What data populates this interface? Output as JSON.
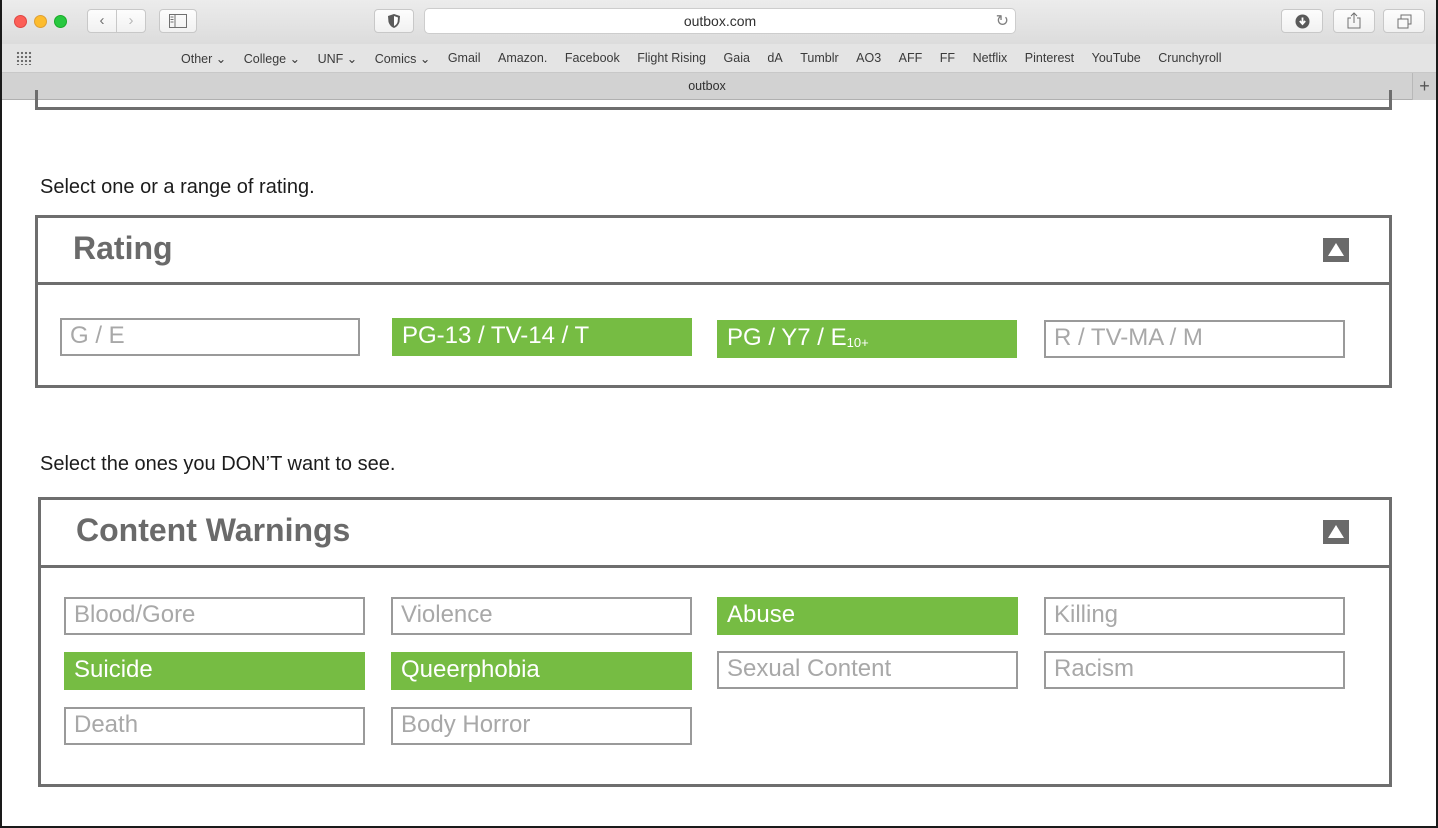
{
  "browser": {
    "url": "outbox.com",
    "tab_title": "outbox",
    "back_glyph": "‹",
    "forward_glyph": "›",
    "new_tab_glyph": "+",
    "bookmarks": [
      "Other ⌄",
      "College ⌄",
      "UNF ⌄",
      "Comics ⌄",
      "Gmail",
      "Amazon.",
      "Facebook",
      "Flight Rising",
      "Gaia",
      "dA",
      "Tumblr",
      "AO3",
      "AFF",
      "FF",
      "Netflix",
      "Pinterest",
      "YouTube",
      "Crunchyroll"
    ]
  },
  "rating": {
    "instruction": "Select one or a range of rating.",
    "title": "Rating",
    "options": [
      {
        "label": "G / E",
        "suffix": "",
        "selected": false
      },
      {
        "label": "PG-13 / TV-14 / T",
        "suffix": "",
        "selected": true
      },
      {
        "label": "PG / Y7 /  E",
        "suffix": "10+",
        "selected": true
      },
      {
        "label": "R / TV-MA / M",
        "suffix": "",
        "selected": false
      }
    ]
  },
  "warnings": {
    "instruction": "Select the ones you DON’T want to see.",
    "title": "Content Warnings",
    "options": [
      {
        "label": "Blood/Gore",
        "selected": false
      },
      {
        "label": "Violence",
        "selected": false
      },
      {
        "label": "Abuse",
        "selected": true
      },
      {
        "label": "Killing",
        "selected": false
      },
      {
        "label": "Suicide",
        "selected": true
      },
      {
        "label": "Queerphobia",
        "selected": true
      },
      {
        "label": "Sexual Content",
        "selected": false
      },
      {
        "label": "Racism",
        "selected": false
      },
      {
        "label": "Death",
        "selected": false
      },
      {
        "label": "Body Horror",
        "selected": false
      }
    ]
  },
  "colors": {
    "selected": "#76bc43",
    "border": "#6e6e6e"
  }
}
